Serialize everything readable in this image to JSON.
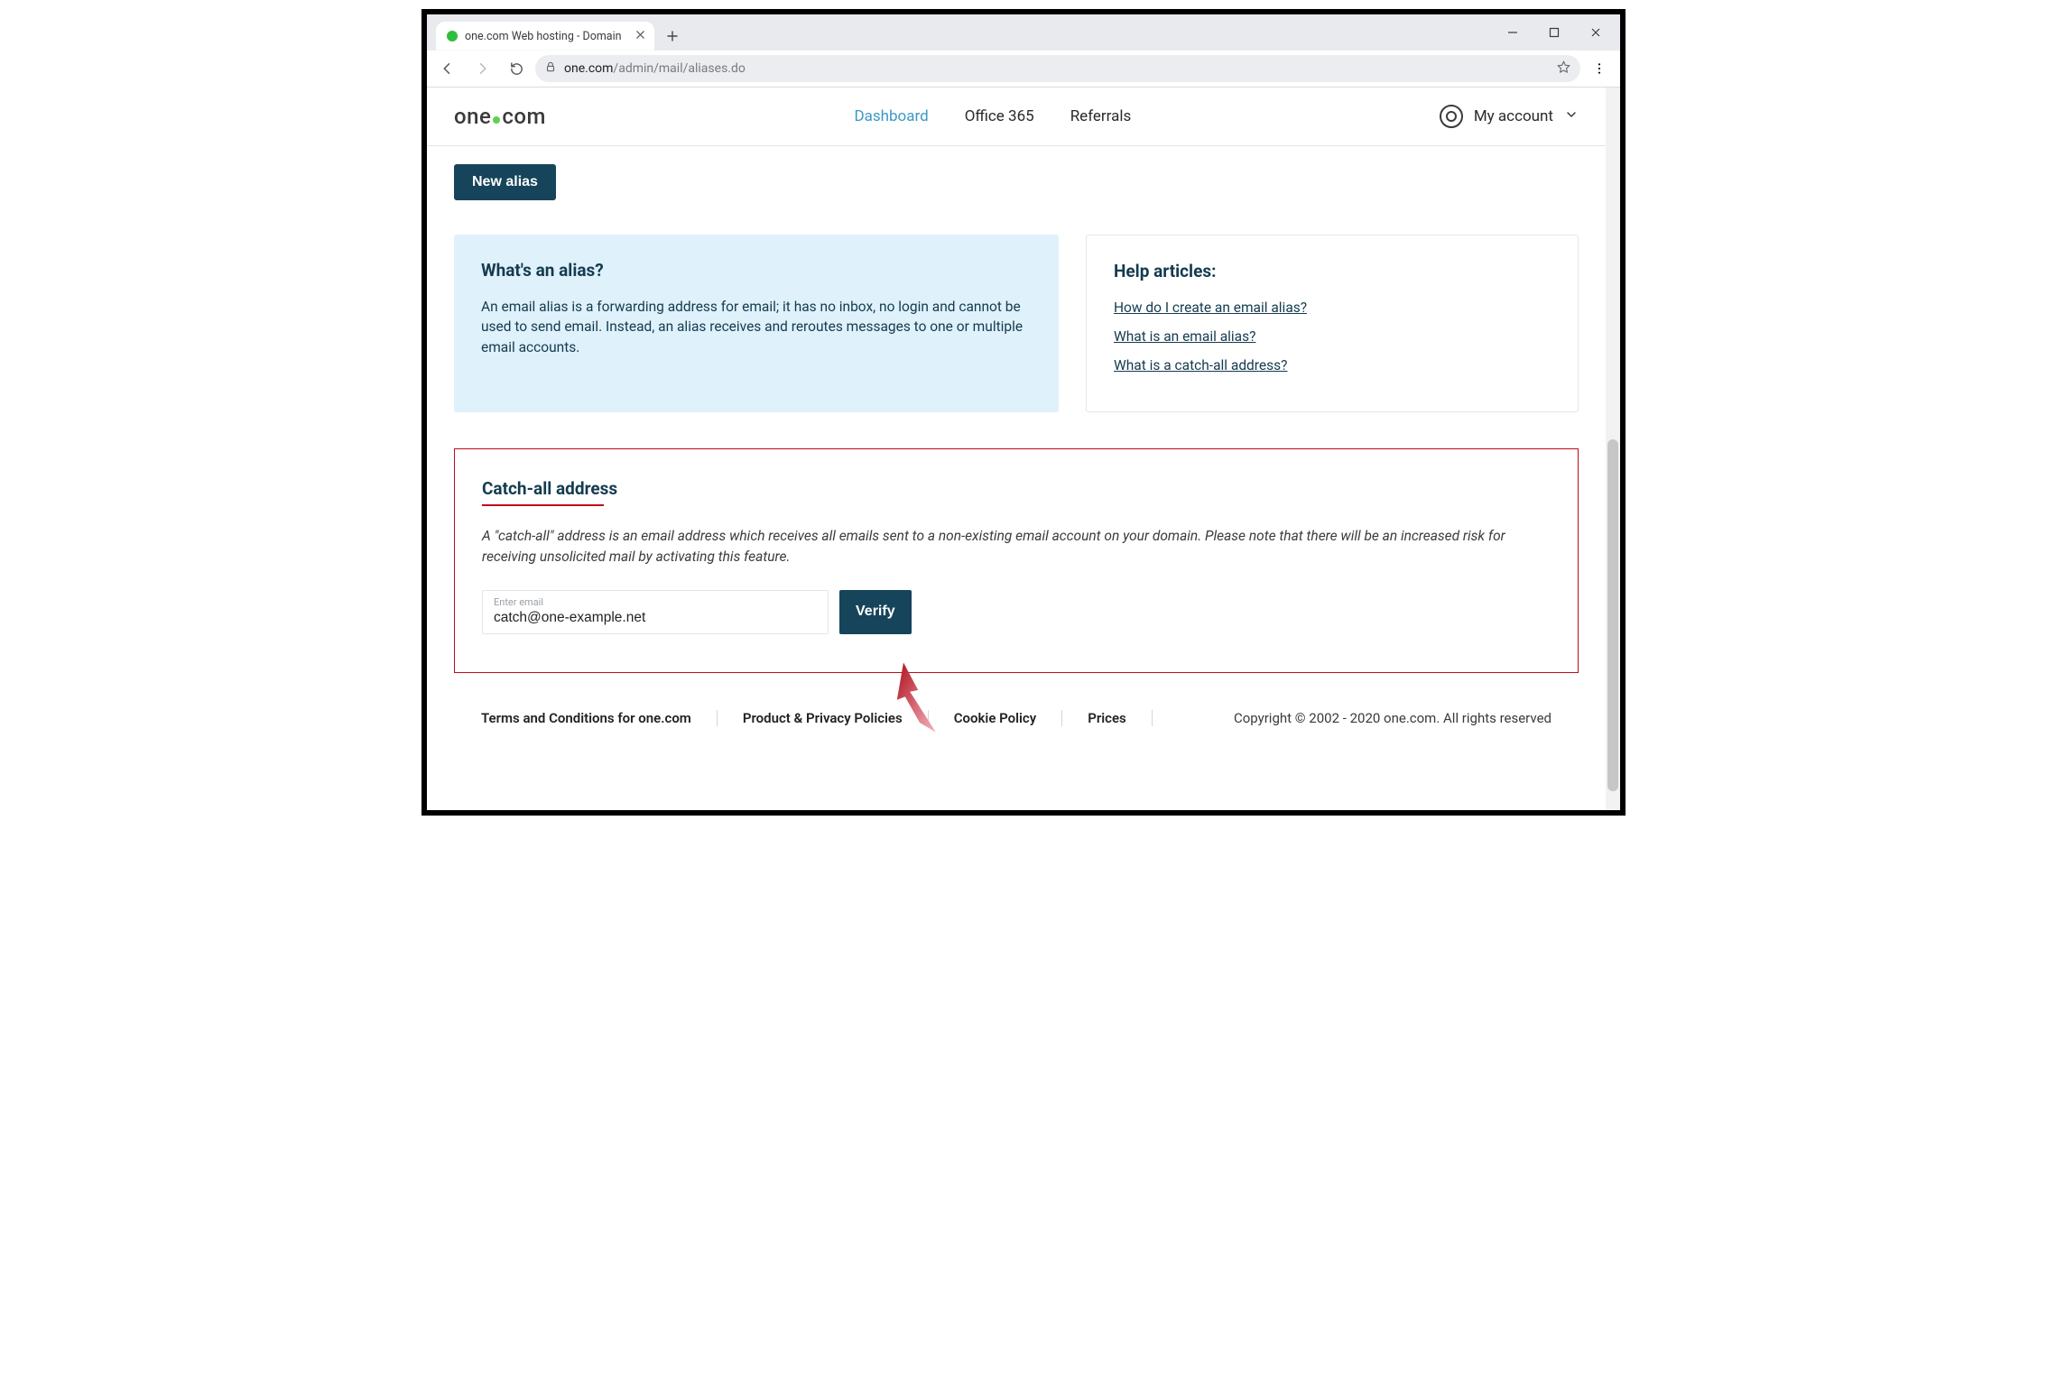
{
  "browser": {
    "tab_title": "one.com Web hosting  -  Domain",
    "url_domain": "one.com",
    "url_path": "/admin/mail/aliases.do"
  },
  "header": {
    "logo_left": "one",
    "logo_right": "com",
    "nav": {
      "dashboard": "Dashboard",
      "office365": "Office 365",
      "referrals": "Referrals"
    },
    "account_label": "My account"
  },
  "actions": {
    "new_alias": "New alias"
  },
  "info_card": {
    "title": "What's an alias?",
    "body": "An email alias is a forwarding address for email; it has no inbox, no login and cannot be used to send email. Instead, an alias receives and reroutes messages to one or multiple email accounts."
  },
  "help_card": {
    "title": "Help articles:",
    "links": [
      "How do I create an email alias?",
      "What is an email alias?",
      "What is a catch-all address?"
    ]
  },
  "catchall": {
    "title": "Catch-all address",
    "body": "A \"catch-all\" address is an email address which receives all emails sent to a non-existing email account on your domain. Please note that there will be an increased risk for receiving unsolicited mail by activating this feature.",
    "field_label": "Enter email",
    "field_value": "catch@one-example.net",
    "verify": "Verify"
  },
  "footer": {
    "terms": "Terms and Conditions for one.com",
    "policies": "Product & Privacy Policies",
    "cookie": "Cookie Policy",
    "prices": "Prices",
    "copyright": "Copyright © 2002 - 2020 one.com. All rights reserved"
  }
}
